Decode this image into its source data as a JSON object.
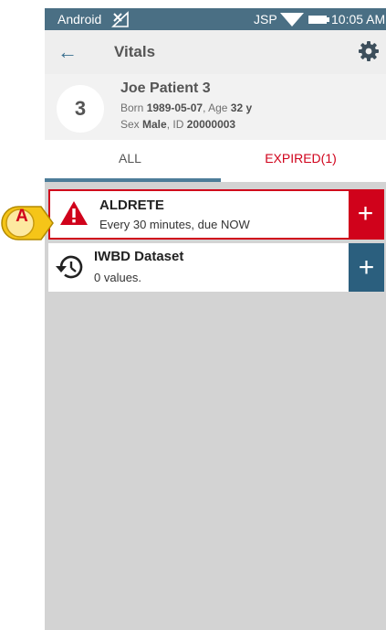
{
  "status_bar": {
    "os_label": "Android",
    "carrier": "JSP",
    "time": "10:05 AM"
  },
  "app_bar": {
    "back_icon": "arrow-left-icon",
    "title": "Vitals",
    "settings_icon": "gear-icon"
  },
  "patient": {
    "bed_number": "3",
    "name": "Joe Patient 3",
    "born_label": "Born ",
    "born_value": "1989-05-07",
    "age_label": ", Age ",
    "age_value": "32 y",
    "sex_label": "Sex ",
    "sex_value": "Male",
    "id_label": ", ID ",
    "id_value": "20000003"
  },
  "tabs": [
    {
      "label": "ALL",
      "selected": true
    },
    {
      "label": "EXPIRED(1)",
      "selected": false
    }
  ],
  "vitals_list": [
    {
      "title": "ALDRETE",
      "subtitle": "Every 30 minutes, due NOW",
      "icon": "warning-triangle-icon",
      "status": "expired",
      "action_label": "+"
    },
    {
      "title": "IWBD Dataset",
      "subtitle": "0 values.",
      "icon": "history-clock-icon",
      "status": "normal",
      "action_label": "+"
    }
  ],
  "annotation": {
    "label": "A"
  },
  "colors": {
    "status_bar": "#4a6f84",
    "accent_red": "#d0021b",
    "accent_blue": "#2b5f7e",
    "background": "#d3d3d3"
  }
}
